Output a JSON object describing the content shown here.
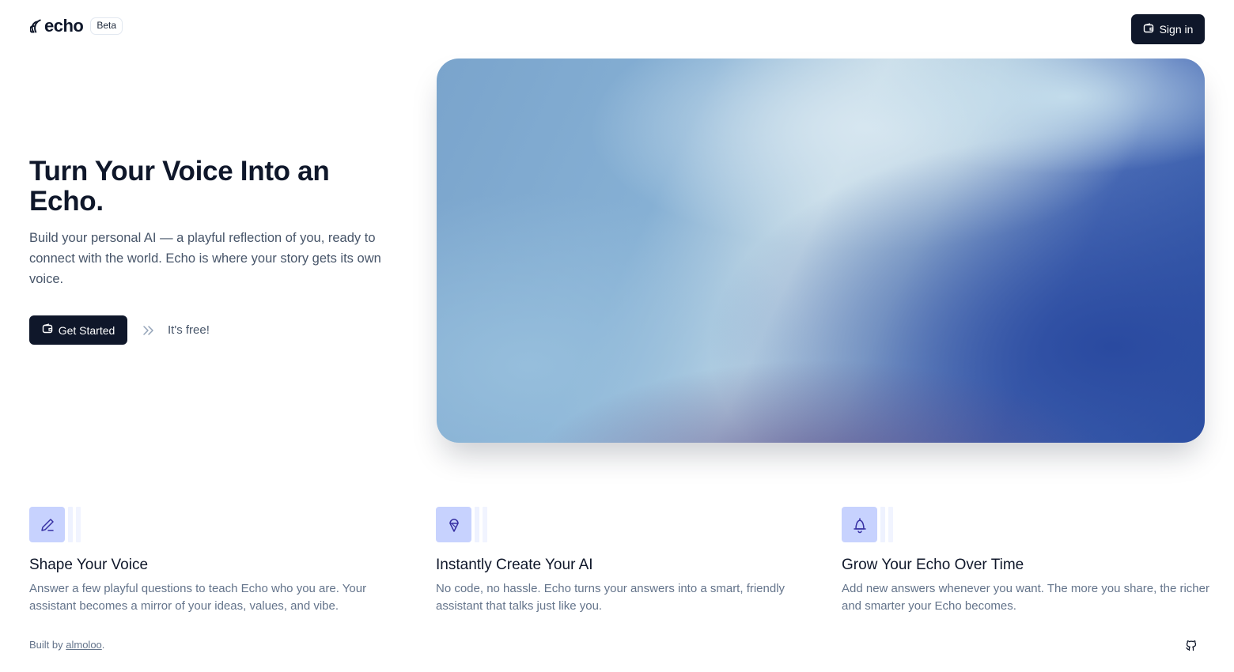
{
  "brand": {
    "name": "echo",
    "badge": "Beta"
  },
  "header": {
    "signin_label": "Sign in"
  },
  "hero": {
    "title": "Turn Your Voice Into an Echo.",
    "subtitle": "Build your personal AI — a playful reflection of you, ready to connect with the world. Echo is where your story gets its own voice.",
    "cta_label": "Get Started",
    "cta_note": "It's free!"
  },
  "features": [
    {
      "icon": "pencil-icon",
      "title": "Shape Your Voice",
      "description": "Answer a few playful questions to teach Echo who you are. Your assistant becomes a mirror of your ideas, values, and vibe."
    },
    {
      "icon": "ice-cream-icon",
      "title": "Instantly Create Your AI",
      "description": "No code, no hassle. Echo turns your answers into a smart, friendly assistant that talks just like you."
    },
    {
      "icon": "bell-icon",
      "title": "Grow Your Echo Over Time",
      "description": "Add new answers whenever you want. The more you share, the richer and smarter your Echo becomes."
    }
  ],
  "footer": {
    "built_by_prefix": "Built by ",
    "author": "almoloo",
    "suffix": "."
  },
  "colors": {
    "primary": "#0f172a",
    "feature_icon_bg": "#c7d2fe",
    "feature_icon_fg": "#3730a3",
    "muted_text": "#64748b"
  }
}
